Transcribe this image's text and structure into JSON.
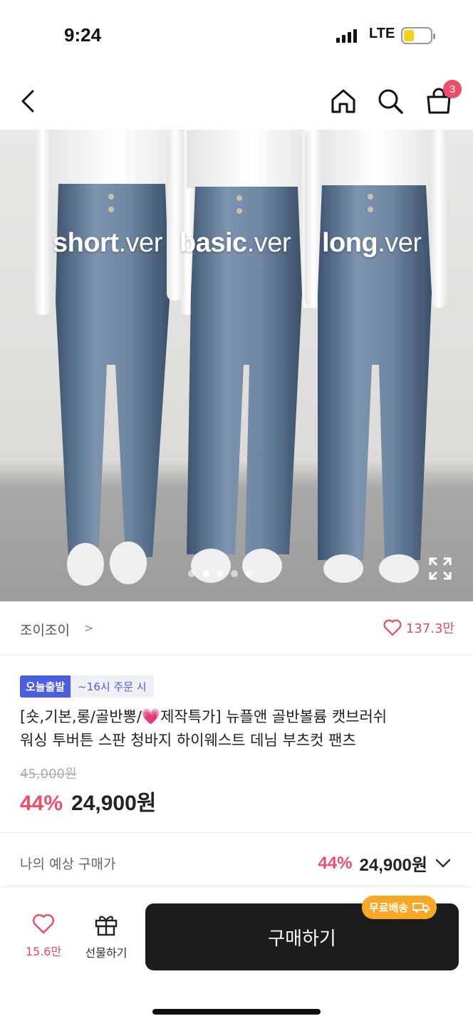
{
  "status": {
    "time": "9:24",
    "network": "LTE"
  },
  "nav": {
    "cart_count": "3"
  },
  "hero": {
    "labels": [
      {
        "bold": "short",
        "light": ".ver"
      },
      {
        "bold": "basic",
        "light": ".ver"
      },
      {
        "bold": "long",
        "light": ".ver"
      }
    ],
    "page_dots": 5,
    "active_dot": 1
  },
  "seller": {
    "name": "조이조이",
    "likes": "137.3만"
  },
  "product": {
    "badge_delivery": "오늘출발",
    "badge_cutoff": "~16시 주문 시",
    "title_line1": "[숏,기본,롱/골반뽕/💗제작특가] 뉴플앤 골반볼륨 캣브러쉬",
    "title_line2": "워싱 투버튼 스판 청바지 하이웨스트 데님 부츠컷 팬츠",
    "original_price": "45,000원",
    "discount": "44%",
    "price": "24,900원"
  },
  "expected": {
    "label": "나의 예상 구매가",
    "discount": "44%",
    "price": "24,900원"
  },
  "bottom": {
    "like_count": "15.6만",
    "gift_label": "선물하기",
    "buy_label": "구매하기",
    "free_shipping": "무료배송"
  },
  "colors": {
    "accent_red": "#ef4e6a",
    "badge_blue": "#4a5fe0",
    "shipping_orange": "#f9a825"
  }
}
